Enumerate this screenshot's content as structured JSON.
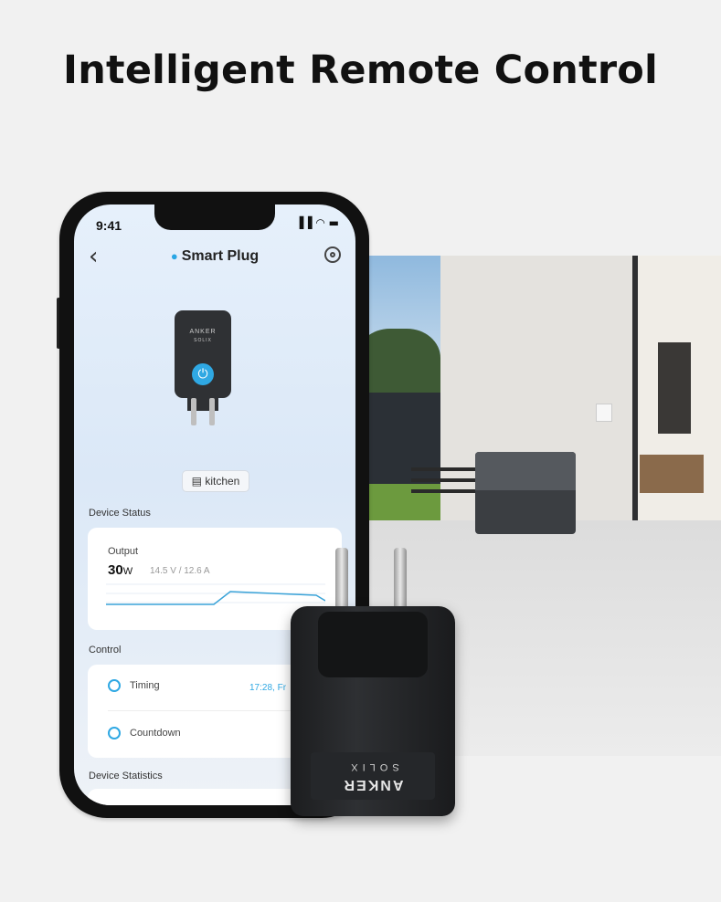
{
  "headline": "Intelligent Remote Control",
  "phone": {
    "status_time": "9:41",
    "status_icons": "▐▐ ◠ ▬",
    "back_glyph": "‹",
    "title": "Smart Plug",
    "plug_brand": "ANKER",
    "plug_sub": "SOLIX",
    "power_glyph": "⏻",
    "room_chip": "kitchen",
    "device_status_label": "Device Status",
    "output_label": "Output",
    "output_value": "30",
    "output_unit": "W",
    "output_detail": "14.5 V / 12.6 A",
    "control_label": "Control",
    "timing_label": "Timing",
    "timing_value": "17:28, Fr",
    "countdown_label": "Countdown",
    "device_statistics_label": "Device Statistics"
  },
  "product": {
    "brand": "ANKER",
    "sub": "SOLIX"
  },
  "colors": {
    "accent": "#2fa8e3",
    "headline": "#111111",
    "background": "#f1f1f1"
  }
}
